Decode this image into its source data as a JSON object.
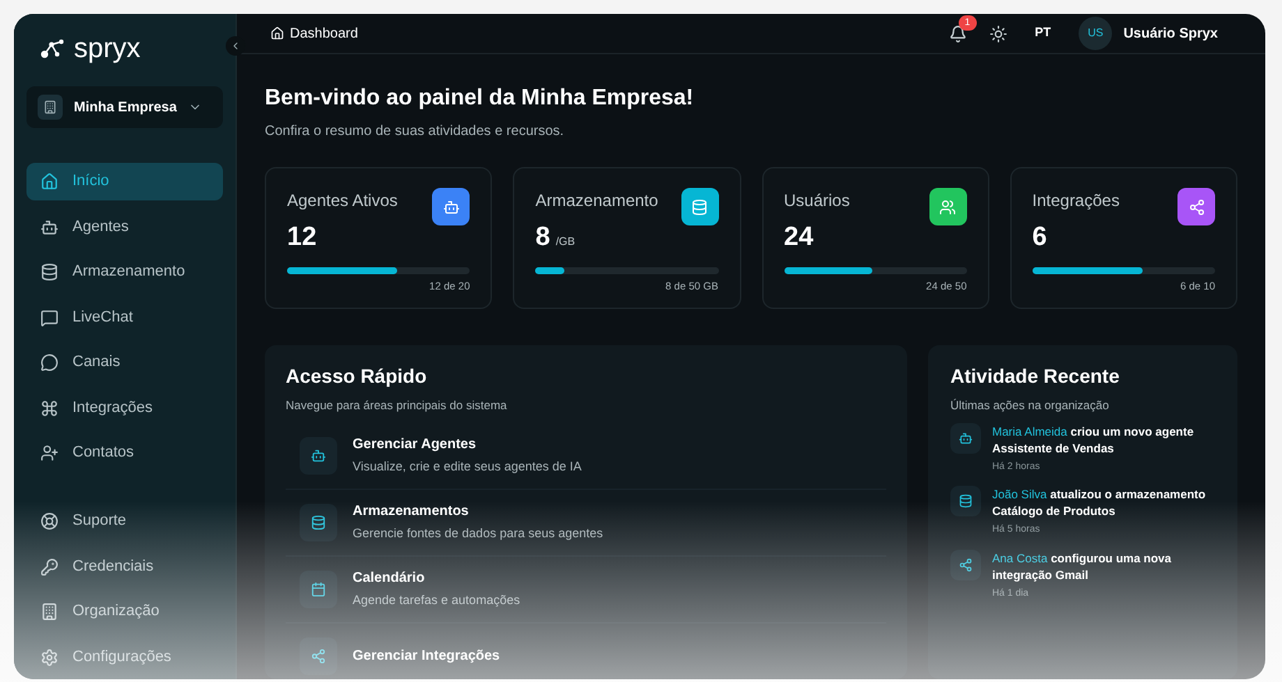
{
  "brand": {
    "name": "spryx"
  },
  "org_switcher": {
    "label": "Minha Empresa"
  },
  "sidebar": {
    "items": [
      {
        "label": "Início",
        "kind": "home",
        "selected": true
      },
      {
        "label": "Agentes",
        "kind": "bot",
        "selected": false
      },
      {
        "label": "Armazenamento",
        "kind": "database",
        "selected": false
      },
      {
        "label": "LiveChat",
        "kind": "chat",
        "selected": false
      },
      {
        "label": "Canais",
        "kind": "bubble",
        "selected": false
      },
      {
        "label": "Integrações",
        "kind": "command",
        "selected": false
      },
      {
        "label": "Contatos",
        "kind": "userplus",
        "selected": false
      }
    ],
    "bottom_items": [
      {
        "label": "Suporte",
        "kind": "lifebuoy",
        "selected": false
      },
      {
        "label": "Credenciais",
        "kind": "key",
        "selected": false
      },
      {
        "label": "Organização",
        "kind": "building",
        "selected": false
      },
      {
        "label": "Configurações",
        "kind": "settings",
        "selected": false
      }
    ]
  },
  "breadcrumb": "Dashboard",
  "topbar": {
    "notifications": "1",
    "language": "PT",
    "user_initials": "US",
    "user_name": "Usuário Spryx"
  },
  "header": {
    "title": "Bem-vindo ao painel da Minha Empresa!",
    "subtitle": "Confira o resumo de suas atividades e recursos."
  },
  "stats": [
    {
      "label": "Agentes Ativos",
      "value": "12",
      "kind": "bot",
      "color": "#3b82f6",
      "level": 0.6,
      "reading": "12 de 20"
    },
    {
      "label": "Armazenamento",
      "value": "8",
      "unit": "/GB",
      "kind": "database",
      "color": "#06b6d4",
      "level": 0.16,
      "reading": "8 de 50 GB"
    },
    {
      "label": "Usuários",
      "value": "24",
      "kind": "users",
      "color": "#22c55e",
      "level": 0.48,
      "reading": "24 de 50"
    },
    {
      "label": "Integrações",
      "value": "6",
      "kind": "share",
      "color": "#a855f7",
      "level": 0.6,
      "reading": "6 de 10"
    }
  ],
  "quick_access": {
    "title": "Acesso Rápido",
    "subtitle": "Navegue para áreas principais do sistema",
    "items": [
      {
        "title": "Gerenciar Agentes",
        "description": "Visualize, crie e edite seus agentes de IA",
        "kind": "bot"
      },
      {
        "title": "Armazenamentos",
        "description": "Gerencie fontes de dados para seus agentes",
        "kind": "database"
      },
      {
        "title": "Calendário",
        "description": "Agende tarefas e automações",
        "kind": "calendar"
      },
      {
        "title": "Gerenciar Integrações",
        "kind": "share"
      }
    ]
  },
  "recent_activity": {
    "title": "Atividade Recente",
    "subtitle": "Últimas ações na organização",
    "items": [
      {
        "user": "Maria Almeida",
        "action": "criou um novo agente",
        "object": "Assistente de Vendas",
        "time": "Há 2 horas",
        "kind": "bot"
      },
      {
        "user": "João Silva",
        "action": "atualizou o armazenamento",
        "object": "Catálogo de Produtos",
        "time": "Há 5 horas",
        "kind": "database"
      },
      {
        "user": "Ana Costa",
        "action": "configurou uma nova",
        "object": "integração Gmail",
        "time": "Há 1 dia",
        "kind": "share"
      }
    ]
  }
}
